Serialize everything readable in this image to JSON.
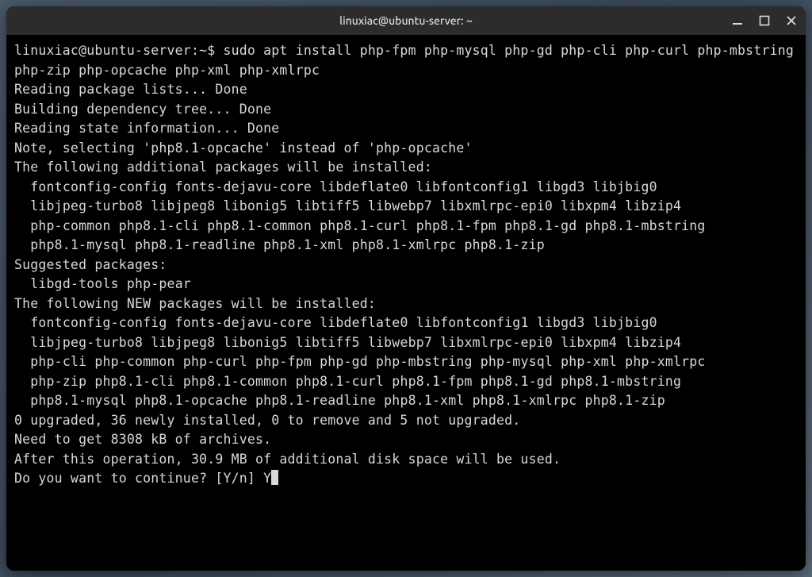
{
  "window": {
    "title": "linuxiac@ubuntu-server: ~"
  },
  "terminal": {
    "prompt": "linuxiac@ubuntu-server:~$ ",
    "command": "sudo apt install php-fpm php-mysql php-gd php-cli php-curl php-mbstring php-zip php-opcache php-xml php-xmlrpc",
    "lines": [
      "Reading package lists... Done",
      "Building dependency tree... Done",
      "Reading state information... Done",
      "Note, selecting 'php8.1-opcache' instead of 'php-opcache'",
      "The following additional packages will be installed:",
      "  fontconfig-config fonts-dejavu-core libdeflate0 libfontconfig1 libgd3 libjbig0",
      "  libjpeg-turbo8 libjpeg8 libonig5 libtiff5 libwebp7 libxmlrpc-epi0 libxpm4 libzip4",
      "  php-common php8.1-cli php8.1-common php8.1-curl php8.1-fpm php8.1-gd php8.1-mbstring",
      "  php8.1-mysql php8.1-readline php8.1-xml php8.1-xmlrpc php8.1-zip",
      "Suggested packages:",
      "  libgd-tools php-pear",
      "The following NEW packages will be installed:",
      "  fontconfig-config fonts-dejavu-core libdeflate0 libfontconfig1 libgd3 libjbig0",
      "  libjpeg-turbo8 libjpeg8 libonig5 libtiff5 libwebp7 libxmlrpc-epi0 libxpm4 libzip4",
      "  php-cli php-common php-curl php-fpm php-gd php-mbstring php-mysql php-xml php-xmlrpc",
      "  php-zip php8.1-cli php8.1-common php8.1-curl php8.1-fpm php8.1-gd php8.1-mbstring",
      "  php8.1-mysql php8.1-opcache php8.1-readline php8.1-xml php8.1-xmlrpc php8.1-zip",
      "0 upgraded, 36 newly installed, 0 to remove and 5 not upgraded.",
      "Need to get 8308 kB of archives.",
      "After this operation, 30.9 MB of additional disk space will be used."
    ],
    "confirm_prompt": "Do you want to continue? [Y/n] ",
    "confirm_response": "Y"
  }
}
